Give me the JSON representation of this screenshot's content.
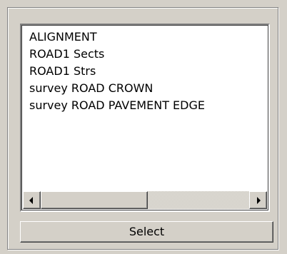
{
  "list": {
    "items": [
      "ALIGNMENT",
      "ROAD1 Sects",
      "ROAD1 Strs",
      "survey ROAD CROWN",
      "survey ROAD PAVEMENT EDGE"
    ],
    "horizontal_scroll_position": 0.0
  },
  "actions": {
    "select_label": "Select"
  },
  "icons": {
    "scroll_left": "arrow-left-icon",
    "scroll_right": "arrow-right-icon"
  },
  "colors": {
    "window_bg": "#d4d0c8",
    "list_bg": "#ffffff",
    "text": "#000000"
  }
}
